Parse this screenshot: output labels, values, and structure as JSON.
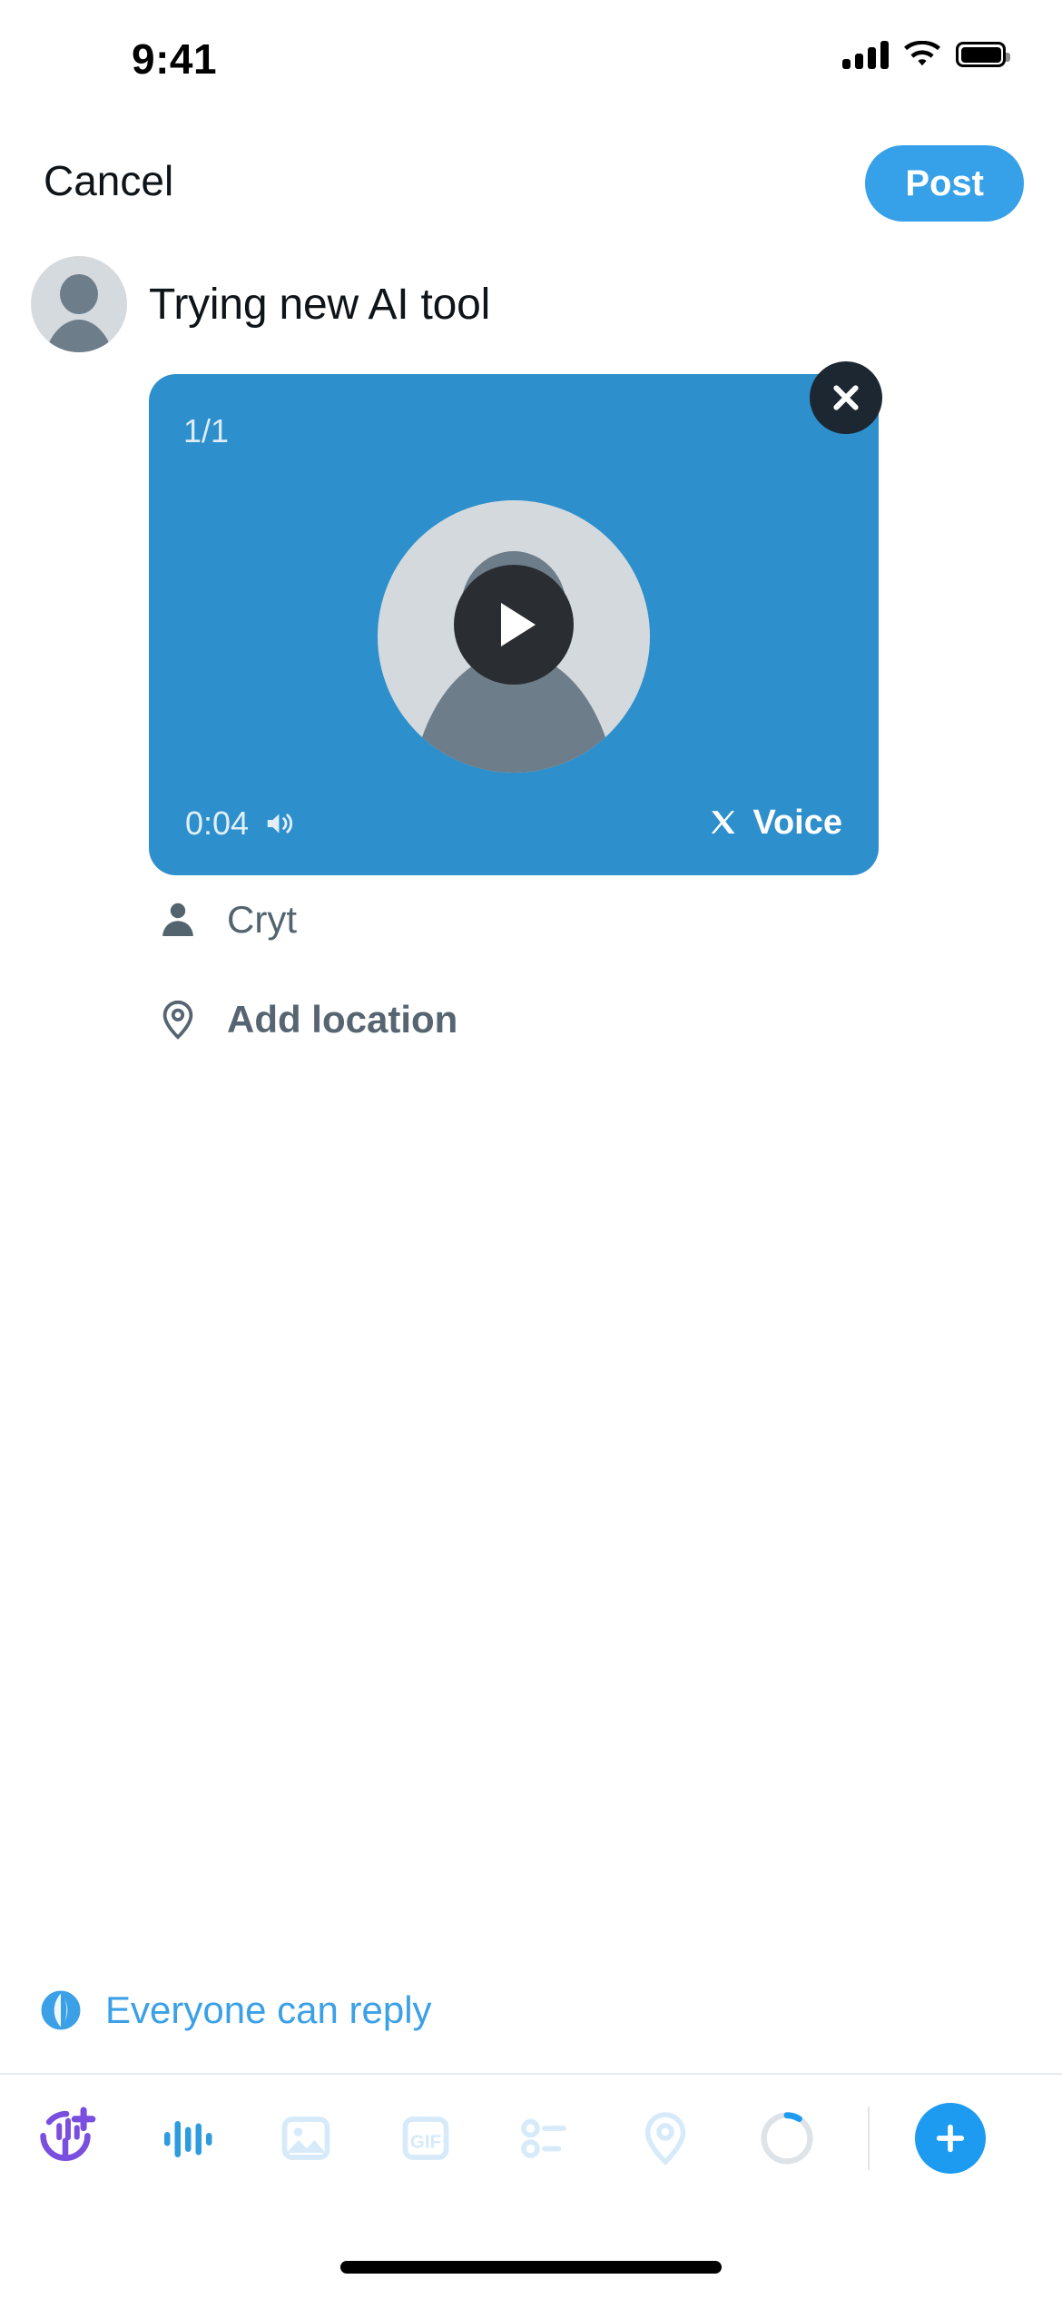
{
  "status_bar": {
    "time": "9:41",
    "signal_icon": "cellular-bars-icon",
    "wifi_icon": "wifi-icon",
    "battery_icon": "battery-full-icon"
  },
  "nav": {
    "cancel_label": "Cancel",
    "post_label": "Post",
    "post_button_color": "#36a0e8"
  },
  "compose": {
    "avatar_icon": "user-avatar",
    "text": "Trying new AI tool"
  },
  "media": {
    "card_color": "#2d8fcc",
    "page_indicator": "1/1",
    "close_icon": "close-icon",
    "play_icon": "play-icon",
    "avatar_icon": "user-avatar",
    "duration": "0:04",
    "speaker_icon": "speaker-icon",
    "brand_icon": "x-logo-icon",
    "brand_label": "Voice"
  },
  "meta": {
    "author_icon": "person-icon",
    "author_label": "Cryt",
    "location_icon": "location-pin-icon",
    "location_label": "Add location"
  },
  "reply_setting": {
    "icon": "globe-icon",
    "label": "Everyone can reply",
    "color": "#3ba0e6"
  },
  "toolbar": {
    "items": [
      {
        "name": "grok-voice-add-icon",
        "label": "Grok voice",
        "state": "enabled",
        "color": "#7a4fe0"
      },
      {
        "name": "audio-waveform-icon",
        "label": "Voice",
        "state": "active",
        "color": "#2f9bdf"
      },
      {
        "name": "image-icon",
        "label": "Media",
        "state": "disabled",
        "color": "#d6eafa"
      },
      {
        "name": "gif-icon",
        "label": "GIF",
        "state": "disabled",
        "color": "#d6eafa"
      },
      {
        "name": "poll-icon",
        "label": "Poll",
        "state": "disabled",
        "color": "#d6eafa"
      },
      {
        "name": "location-pin-icon",
        "label": "Location",
        "state": "disabled",
        "color": "#d6eafa"
      },
      {
        "name": "character-count-ring",
        "label": "Characters",
        "state": "enabled",
        "color": "#1d9bf0"
      }
    ],
    "add_button_icon": "plus-icon",
    "add_button_color": "#1d9bf0"
  }
}
